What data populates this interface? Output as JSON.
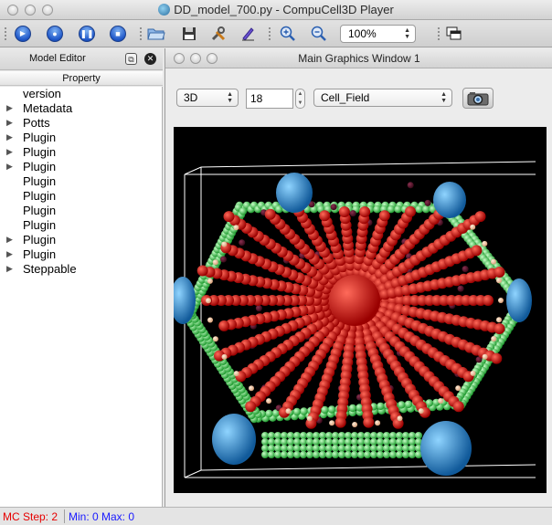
{
  "window": {
    "title": "DD_model_700.py - CompuCell3D Player"
  },
  "toolbar": {
    "zoom_value": "100%",
    "buttons": [
      {
        "name": "run-icon",
        "label": "Run"
      },
      {
        "name": "step-icon",
        "label": "Step"
      },
      {
        "name": "pause-icon",
        "label": "Pause"
      },
      {
        "name": "stop-icon",
        "label": "Stop"
      },
      {
        "name": "open-icon",
        "label": "Open"
      },
      {
        "name": "save-icon",
        "label": "Save"
      },
      {
        "name": "tools-icon",
        "label": "Tools"
      },
      {
        "name": "edit-icon",
        "label": "Edit"
      },
      {
        "name": "zoom-in-icon",
        "label": "Zoom In"
      },
      {
        "name": "zoom-out-icon",
        "label": "Zoom Out"
      },
      {
        "name": "new-window-icon",
        "label": "New Graphics Window"
      }
    ]
  },
  "model_editor": {
    "title": "Model Editor",
    "column_header": "Property",
    "items": [
      {
        "label": "version",
        "expandable": false
      },
      {
        "label": "Metadata",
        "expandable": true
      },
      {
        "label": "Potts",
        "expandable": true
      },
      {
        "label": "Plugin",
        "expandable": true
      },
      {
        "label": "Plugin",
        "expandable": true
      },
      {
        "label": "Plugin",
        "expandable": true
      },
      {
        "label": "Plugin",
        "expandable": false
      },
      {
        "label": "Plugin",
        "expandable": false
      },
      {
        "label": "Plugin",
        "expandable": false
      },
      {
        "label": "Plugin",
        "expandable": false
      },
      {
        "label": "Plugin",
        "expandable": true
      },
      {
        "label": "Plugin",
        "expandable": true
      },
      {
        "label": "Steppable",
        "expandable": true
      }
    ]
  },
  "graphics_window": {
    "title": "Main Graphics Window 1",
    "view_mode": "3D",
    "slice_value": "18",
    "field": "Cell_Field"
  },
  "status_bar": {
    "mc_step": "MC Step: 2",
    "min_max": "Min: 0 Max: 0"
  },
  "colors": {
    "mc_step": "#e60000",
    "min_max": "#1a1aff",
    "cell_red": "#e00000",
    "cell_green": "#33cc44",
    "cell_blue": "#1e8fd6"
  }
}
